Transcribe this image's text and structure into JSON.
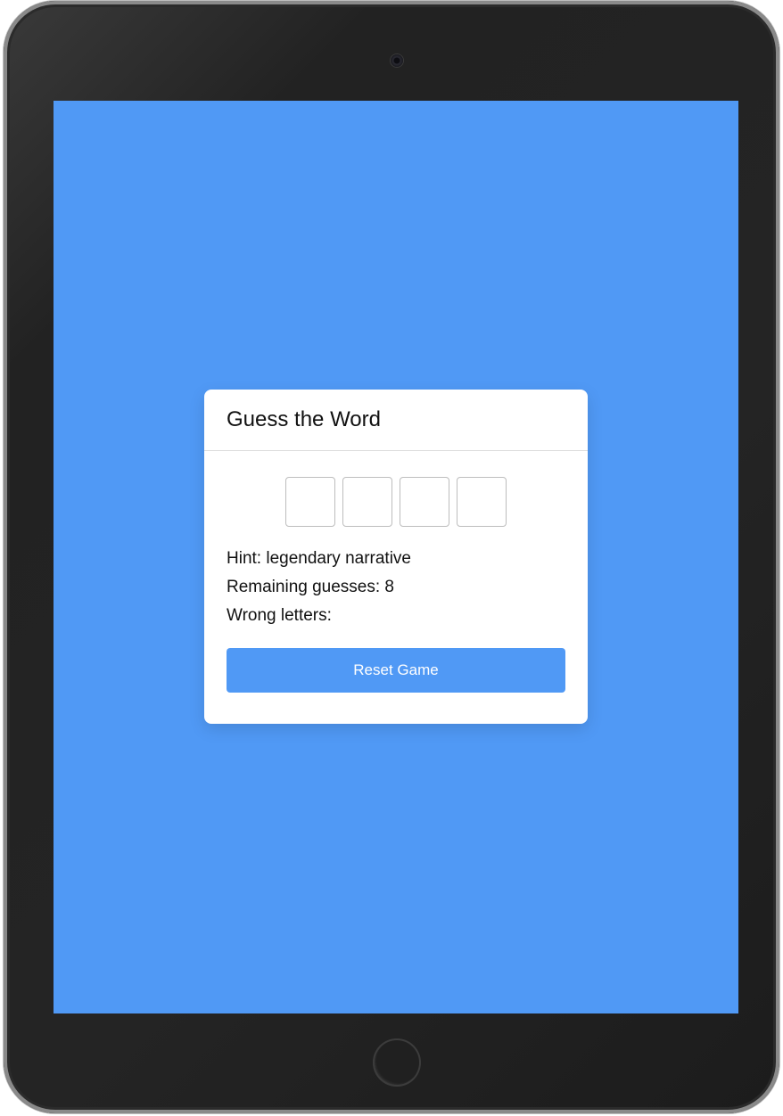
{
  "colors": {
    "screen_background": "#5099f5",
    "button_background": "#5099f5",
    "card_background": "#ffffff"
  },
  "game": {
    "title": "Guess the Word",
    "letters": [
      "",
      "",
      "",
      ""
    ],
    "hint_label": "Hint: legendary narrative",
    "remaining_label": "Remaining guesses: 8",
    "wrong_letters_label": "Wrong letters:",
    "reset_button_label": "Reset Game"
  }
}
